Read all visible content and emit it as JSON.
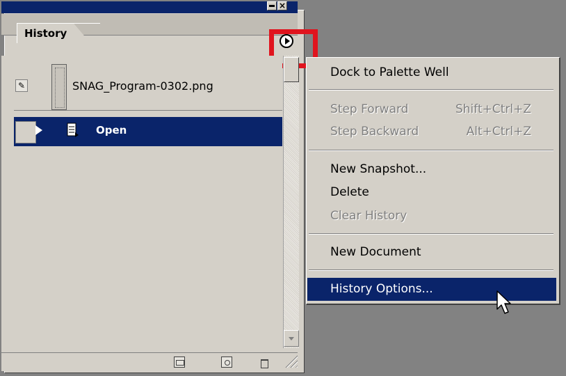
{
  "palette": {
    "tab_label": "History",
    "snapshot_name": "SNAG_Program-0302.png",
    "history_state": "Open"
  },
  "menu": {
    "items": [
      {
        "label": "Dock to Palette Well",
        "shortcut": "",
        "enabled": true
      },
      {
        "label": "Step Forward",
        "shortcut": "Shift+Ctrl+Z",
        "enabled": false
      },
      {
        "label": "Step Backward",
        "shortcut": "Alt+Ctrl+Z",
        "enabled": false
      },
      {
        "label": "New Snapshot...",
        "shortcut": "",
        "enabled": true
      },
      {
        "label": "Delete",
        "shortcut": "",
        "enabled": true
      },
      {
        "label": "Clear History",
        "shortcut": "",
        "enabled": false
      },
      {
        "label": "New Document",
        "shortcut": "",
        "enabled": true
      },
      {
        "label": "History Options...",
        "shortcut": "",
        "enabled": true,
        "highlighted": true
      }
    ]
  },
  "colors": {
    "selection": "#0a246a",
    "panel_bg": "#d4d0c8",
    "highlight_box": "#e0141e",
    "desktop_bg": "#828282"
  },
  "icons": [
    "minimize-icon",
    "close-icon",
    "palette-menu-arrow-icon",
    "brush-icon",
    "history-state-icon",
    "new-document-icon",
    "camera-icon",
    "trash-icon",
    "mouse-pointer-icon"
  ]
}
